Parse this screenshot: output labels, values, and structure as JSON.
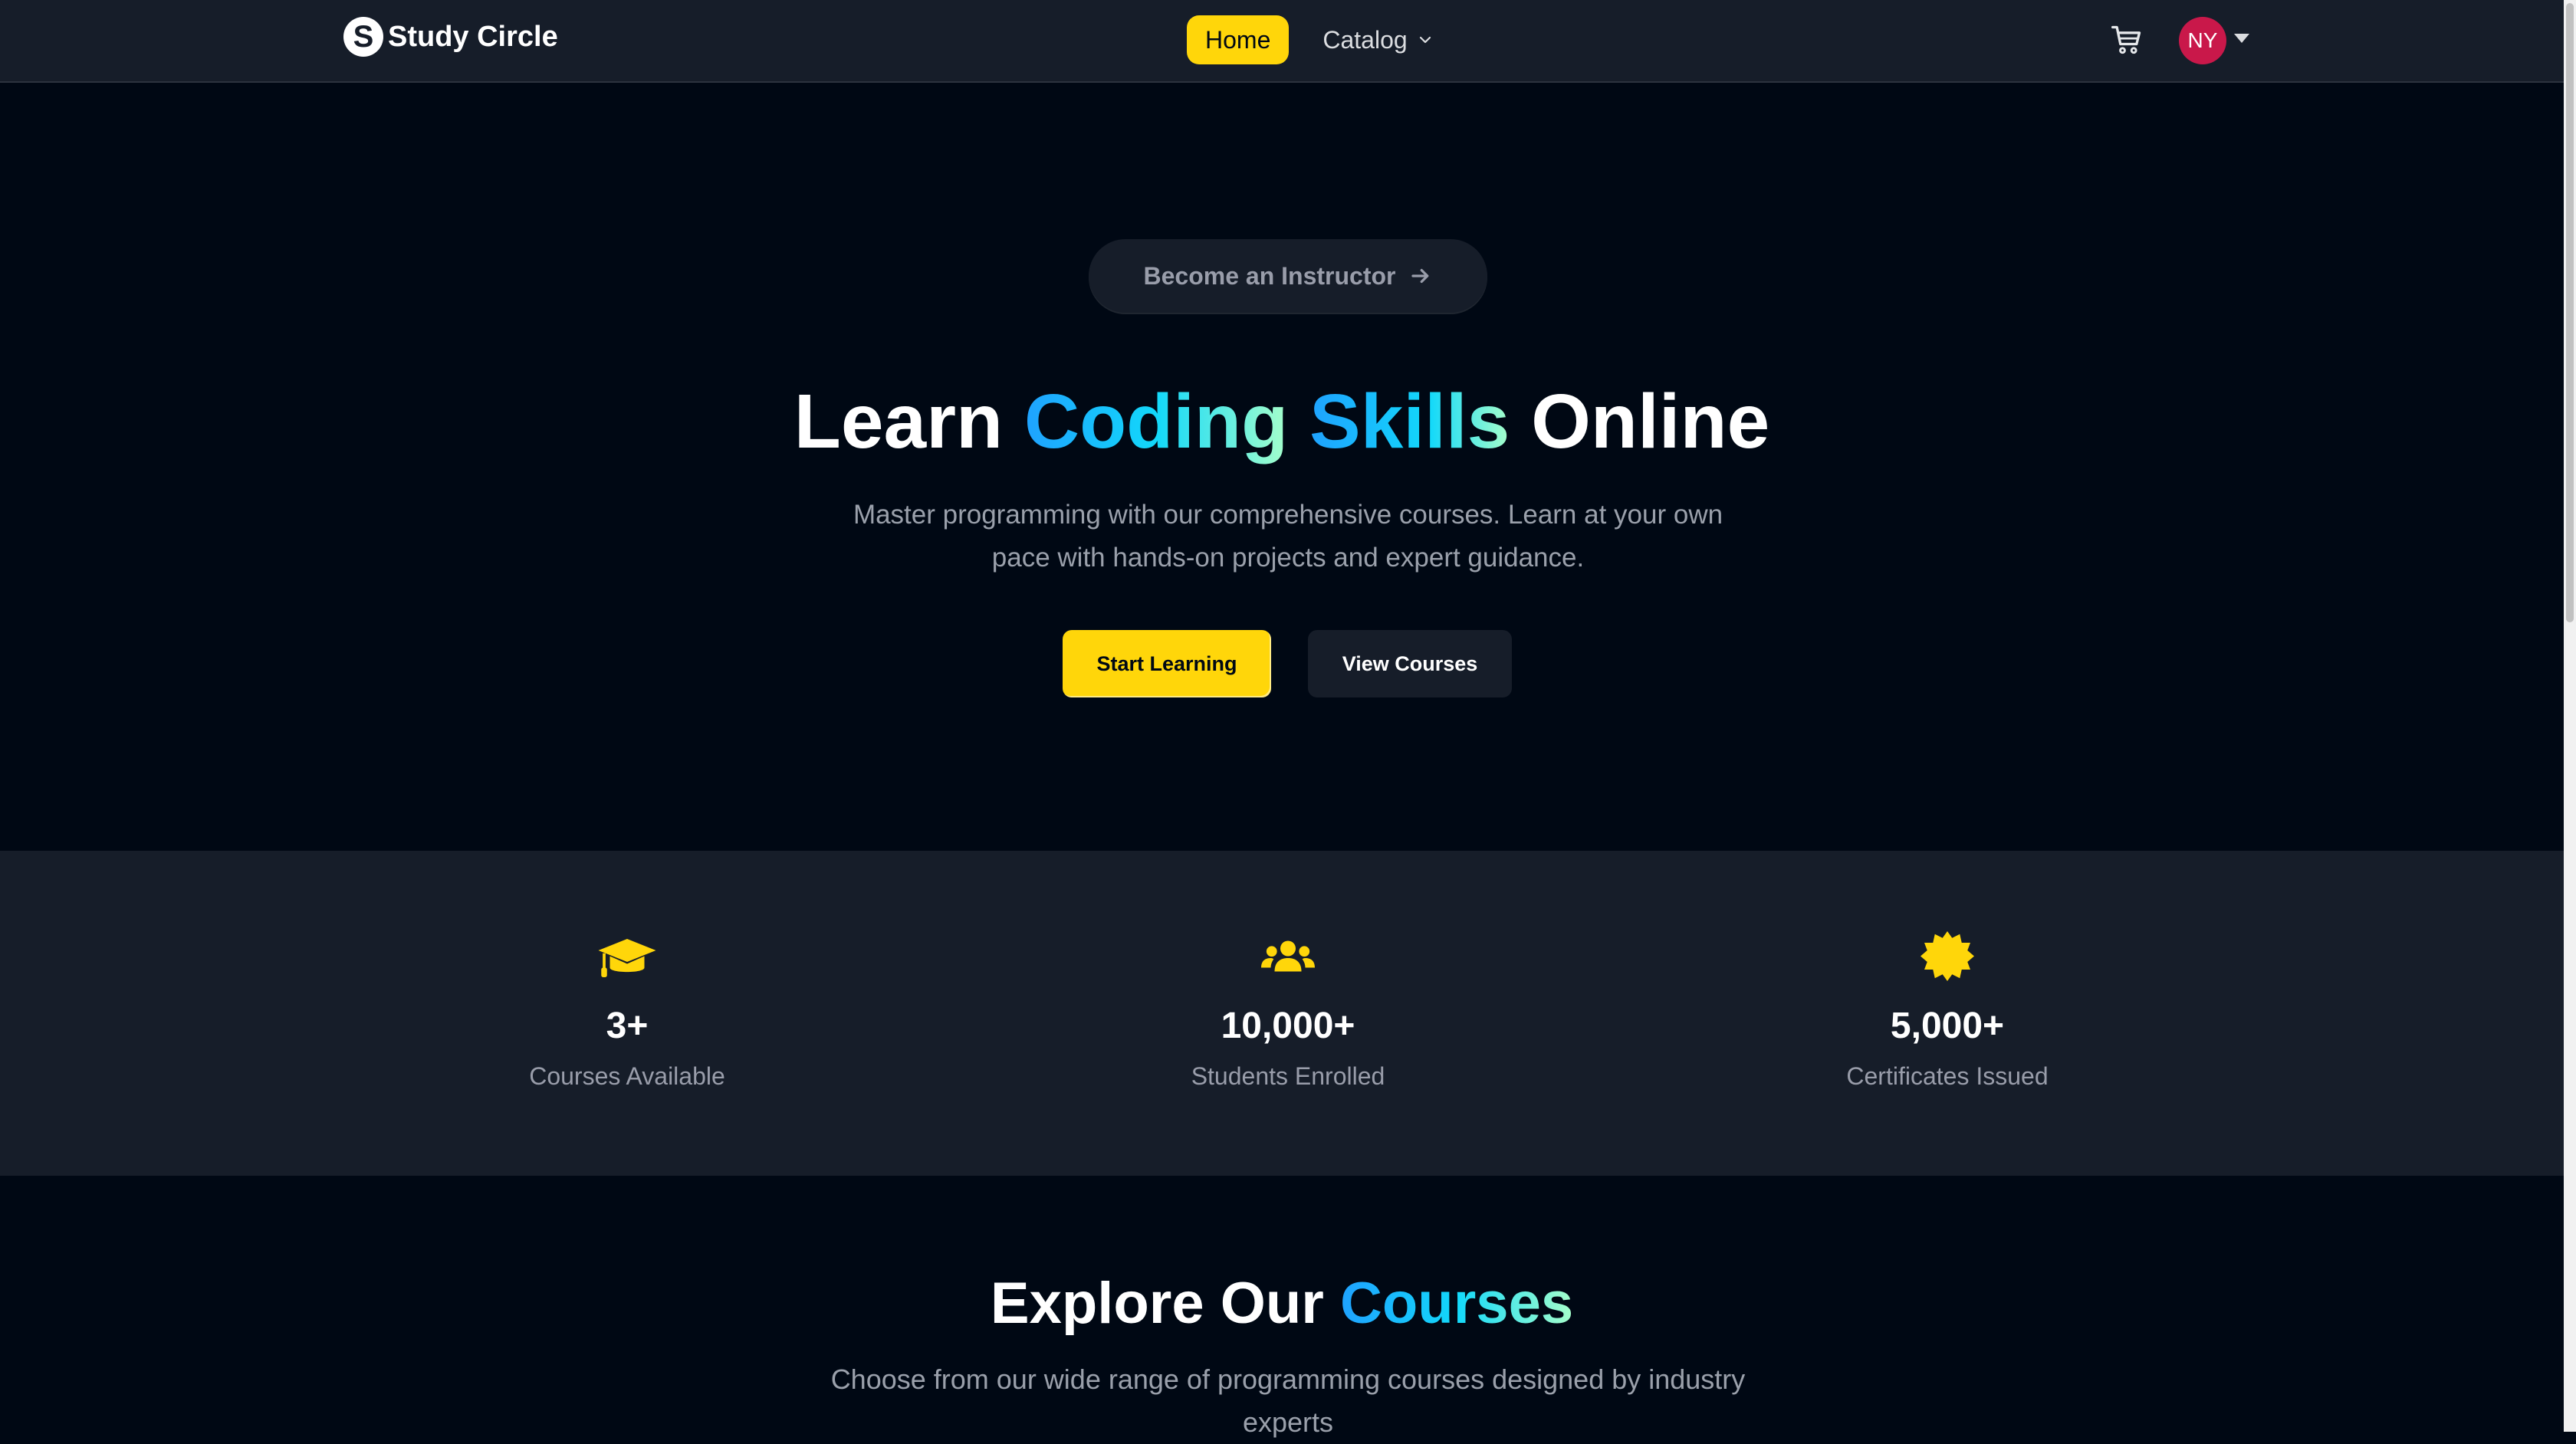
{
  "navbar": {
    "brand": "Study Circle",
    "brand_mark": "S",
    "links": {
      "home": "Home",
      "catalog": "Catalog"
    },
    "avatar_initials": "NY",
    "icons": {
      "cart": "cart-icon",
      "catalog_caret": "chevron-down-icon",
      "profile_caret": "caret-down-icon"
    }
  },
  "hero": {
    "pill_label": "Become an Instructor",
    "title": {
      "part1": "Learn ",
      "part2": "Coding",
      "part3": " ",
      "part4": "Skills",
      "part5": " Online"
    },
    "subtitle": "Master programming with our comprehensive courses. Learn at your own pace with hands-on projects and expert guidance.",
    "primary_button": "Start Learning",
    "secondary_button": "View Courses"
  },
  "stats": [
    {
      "icon": "graduation-cap-icon",
      "value": "3+",
      "label": "Courses Available"
    },
    {
      "icon": "users-icon",
      "value": "10,000+",
      "label": "Students Enrolled"
    },
    {
      "icon": "certificate-badge-icon",
      "value": "5,000+",
      "label": "Certificates Issued"
    }
  ],
  "explore": {
    "title_plain": "Explore Our ",
    "title_highlight": "Courses",
    "subtitle": "Choose from our wide range of programming courses designed by industry experts"
  },
  "colors": {
    "accent_yellow": "#FFD60A",
    "page_bg": "#000814",
    "panel_bg": "#161D29",
    "avatar_bg": "#C9184A"
  }
}
